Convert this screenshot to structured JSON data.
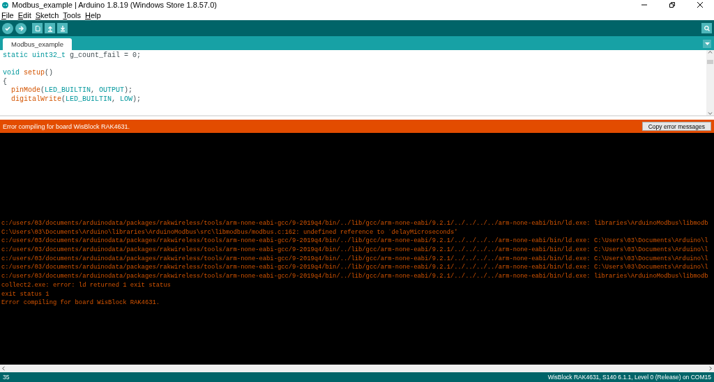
{
  "window": {
    "title": "Modbus_example | Arduino 1.8.19 (Windows Store 1.8.57.0)"
  },
  "menu": [
    "File",
    "Edit",
    "Sketch",
    "Tools",
    "Help"
  ],
  "toolbar": [
    {
      "kind": "verify"
    },
    {
      "kind": "upload"
    },
    {
      "kind": "new"
    },
    {
      "kind": "open"
    },
    {
      "kind": "save"
    }
  ],
  "tabs": [
    {
      "label": "Modbus_example",
      "selected": true
    }
  ],
  "editor": {
    "blocks": [
      [
        {
          "tokens": [
            {
              "text": "static uint32_t",
              "kind": "keyword"
            },
            {
              "text": " g_count_fail = 0;",
              "kind": "plain"
            }
          ]
        }
      ],
      [
        {
          "tokens": [
            {
              "text": "void",
              "kind": "keyword"
            },
            {
              "text": " setup",
              "kind": "function"
            },
            {
              "text": "()",
              "kind": "plain"
            }
          ]
        },
        {
          "tokens": [
            {
              "text": "{",
              "kind": "plain"
            }
          ]
        },
        {
          "tokens": [
            {
              "text": "  pinMode",
              "kind": "function"
            },
            {
              "text": "(",
              "kind": "plain"
            },
            {
              "text": "LED_BUILTIN",
              "kind": "keyword"
            },
            {
              "text": ", ",
              "kind": "plain"
            },
            {
              "text": "OUTPUT",
              "kind": "keyword"
            },
            {
              "text": ");",
              "kind": "plain"
            }
          ]
        },
        {
          "tokens": [
            {
              "text": "  digitalWrite",
              "kind": "function"
            },
            {
              "text": "(",
              "kind": "plain"
            },
            {
              "text": "LED_BUILTIN",
              "kind": "keyword"
            },
            {
              "text": ", ",
              "kind": "plain"
            },
            {
              "text": "LOW",
              "kind": "keyword"
            },
            {
              "text": ");",
              "kind": "plain"
            }
          ]
        }
      ]
    ]
  },
  "message_bar": {
    "message": "Error compiling for board WisBlock RAK4631.",
    "button": "Copy error messages"
  },
  "console": {
    "lines": [
      "c:/users/03/documents/arduinodata/packages/rakwireless/tools/arm-none-eabi-gcc/9-2019q4/bin/../lib/gcc/arm-none-eabi/9.2.1/../../../../arm-none-eabi/bin/ld.exe: libraries\\ArduinoModbus\\libmodb",
      "C:\\Users\\03\\Documents\\Arduino\\libraries\\ArduinoModbus\\src\\libmodbus/modbus.c:162: undefined reference to `delayMicroseconds'",
      "c:/users/03/documents/arduinodata/packages/rakwireless/tools/arm-none-eabi-gcc/9-2019q4/bin/../lib/gcc/arm-none-eabi/9.2.1/../../../../arm-none-eabi/bin/ld.exe: C:\\Users\\03\\Documents\\Arduino\\l",
      "c:/users/03/documents/arduinodata/packages/rakwireless/tools/arm-none-eabi-gcc/9-2019q4/bin/../lib/gcc/arm-none-eabi/9.2.1/../../../../arm-none-eabi/bin/ld.exe: C:\\Users\\03\\Documents\\Arduino\\l",
      "c:/users/03/documents/arduinodata/packages/rakwireless/tools/arm-none-eabi-gcc/9-2019q4/bin/../lib/gcc/arm-none-eabi/9.2.1/../../../../arm-none-eabi/bin/ld.exe: C:\\Users\\03\\Documents\\Arduino\\l",
      "c:/users/03/documents/arduinodata/packages/rakwireless/tools/arm-none-eabi-gcc/9-2019q4/bin/../lib/gcc/arm-none-eabi/9.2.1/../../../../arm-none-eabi/bin/ld.exe: C:\\Users\\03\\Documents\\Arduino\\l",
      "c:/users/03/documents/arduinodata/packages/rakwireless/tools/arm-none-eabi-gcc/9-2019q4/bin/../lib/gcc/arm-none-eabi/9.2.1/../../../../arm-none-eabi/bin/ld.exe: libraries\\ArduinoModbus\\libmodb",
      "collect2.exe: error: ld returned 1 exit status",
      "exit status 1",
      "Error compiling for board WisBlock RAK4631."
    ]
  },
  "status_bar": {
    "line": "35",
    "board": "WisBlock RAK4631, S140 6.1.1, Level 0 (Release) on COM15"
  }
}
